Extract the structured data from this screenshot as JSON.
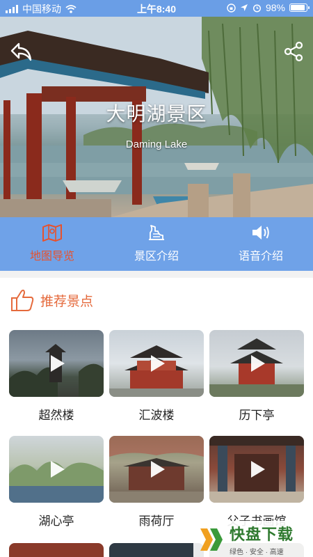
{
  "status_bar": {
    "carrier": "中国移动",
    "time": "上午8:40",
    "battery": "98%",
    "battery_level": 0.98
  },
  "hero": {
    "title": "大明湖景区",
    "subtitle": "Daming Lake"
  },
  "tabs": [
    {
      "label": "地图导览",
      "icon": "map-icon",
      "active": true
    },
    {
      "label": "景区介绍",
      "icon": "scenic-icon",
      "active": false
    },
    {
      "label": "语音介绍",
      "icon": "speaker-icon",
      "active": false
    }
  ],
  "section": {
    "title": "推荐景点",
    "icon": "thumbs-up-icon"
  },
  "spots": [
    {
      "name": "超然楼"
    },
    {
      "name": "汇波楼"
    },
    {
      "name": "历下亭"
    },
    {
      "name": "湖心亭"
    },
    {
      "name": "雨荷厅"
    },
    {
      "name": "父子书画馆"
    }
  ],
  "watermark": {
    "brand": "快盘下载",
    "tagline": "绿色 · 安全 · 高速"
  },
  "colors": {
    "status_bar": "#6a9ee6",
    "tab_bar": "#6fa2e8",
    "active_tab": "#e8512b",
    "section_accent": "#e56a3c"
  }
}
